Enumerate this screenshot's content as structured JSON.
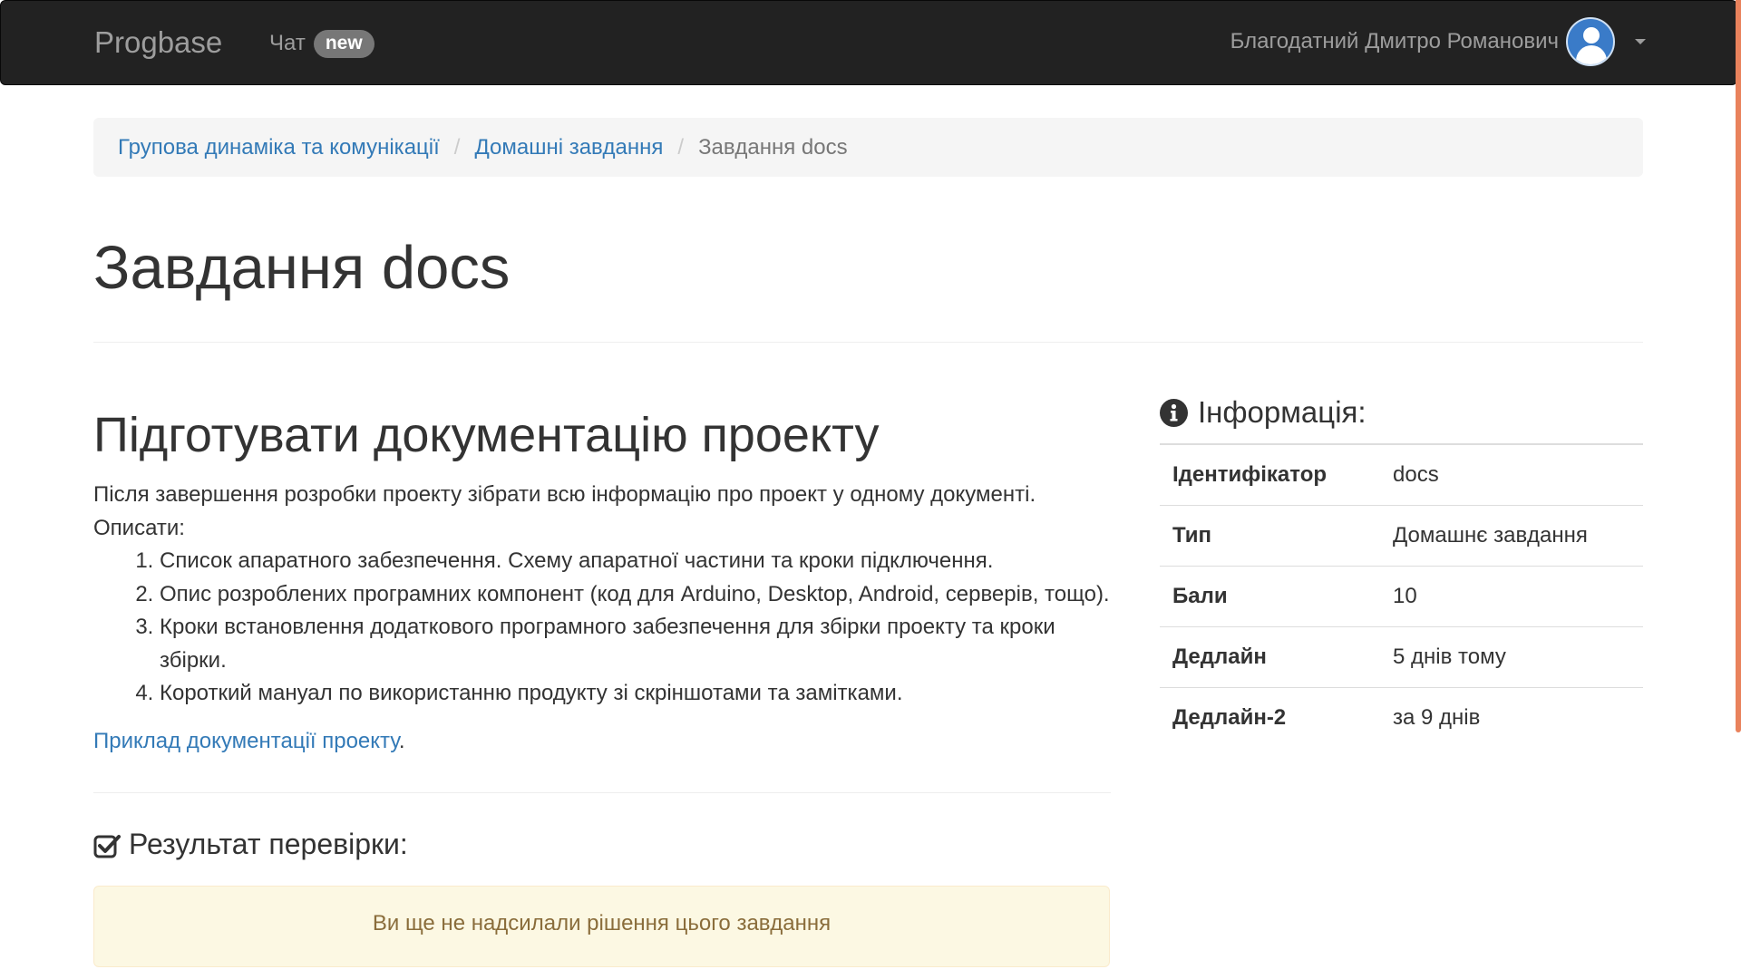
{
  "navbar": {
    "brand": "Progbase",
    "chat_label": "Чат",
    "chat_badge": "new",
    "user_name": "Благодатний Дмитро Романович",
    "avatar_icon": "user-avatar-icon",
    "dropdown_icon": "caret-down-icon"
  },
  "breadcrumb": {
    "items": [
      {
        "label": "Групова динаміка та комунікації",
        "link": true
      },
      {
        "label": "Домашні завдання",
        "link": true
      },
      {
        "label": "Завдання docs",
        "link": false
      }
    ]
  },
  "page": {
    "title": "Завдання docs"
  },
  "task": {
    "heading": "Підготувати документацію проекту",
    "description": "Після завершення розробки проекту зібрати всю інформацію про проект у одному документі. Описати:",
    "list": [
      "Список апаратного забезпечення. Схему апаратної частини та кроки підключення.",
      "Опис розроблених програмних компонент (код для Arduino, Desktop, Android, серверів, тощо).",
      "Кроки встановлення додаткового програмного забезпечення для збірки проекту та кроки збірки.",
      "Короткий мануал по використанню продукту зі скріншотами та замітками."
    ],
    "example_link": "Приклад документації проекту",
    "example_suffix": "."
  },
  "result": {
    "heading": "Результат перевірки:",
    "icon": "check-square-icon",
    "alert_text": "Ви ще не надсилали рішення цього завдання"
  },
  "info": {
    "heading": "Інформація:",
    "icon": "info-circle-icon",
    "rows": [
      {
        "key": "Ідентифікатор",
        "value": "docs"
      },
      {
        "key": "Тип",
        "value": "Домашнє завдання"
      },
      {
        "key": "Бали",
        "value": "10"
      },
      {
        "key": "Дедлайн",
        "value": "5 днів тому"
      },
      {
        "key": "Дедлайн-2",
        "value": "за 9 днів"
      }
    ]
  },
  "colors": {
    "navbar_bg": "#222222",
    "navbar_text": "#9d9d9d",
    "link": "#337ab7",
    "alert_bg": "#fcf8e3",
    "alert_text": "#8a6d3b",
    "scrollbar": "#e9825c"
  }
}
